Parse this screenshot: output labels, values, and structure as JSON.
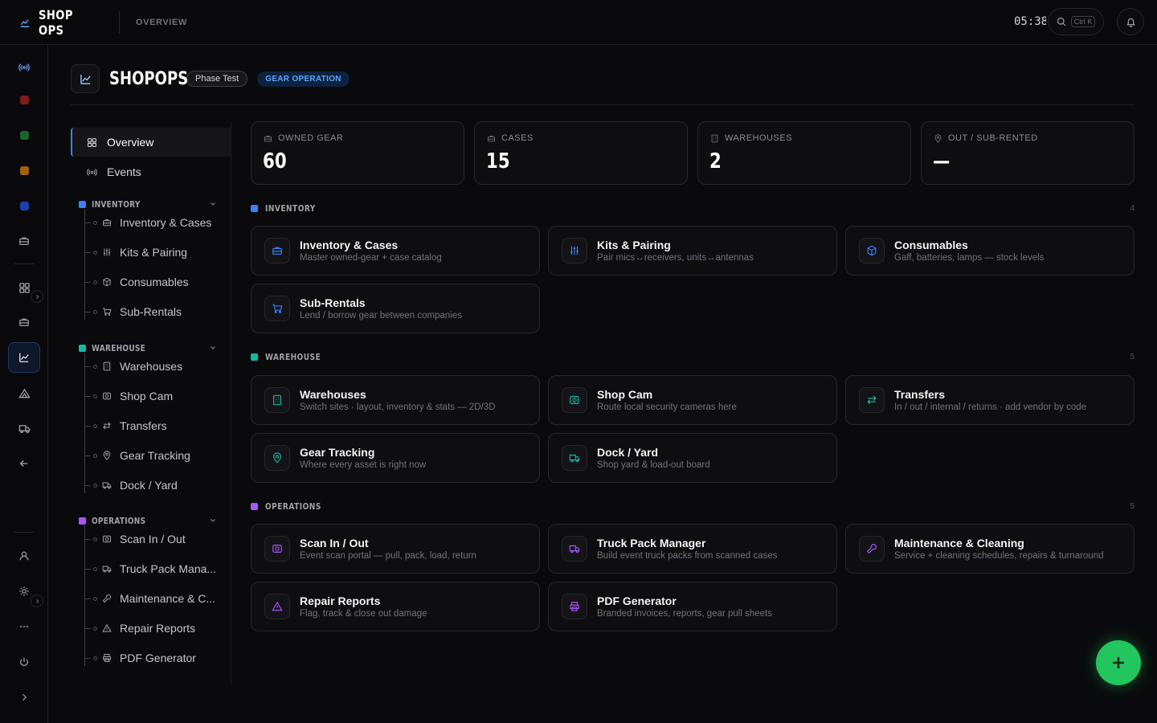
{
  "app": {
    "name": "SHOP OPS",
    "crumb": "OVERVIEW",
    "clock": "05:38",
    "search_kbd": "Ctrl K"
  },
  "rail": {
    "square_colors": [
      "#7f1d1d",
      "#166534",
      "#a16207",
      "#1e40af"
    ]
  },
  "page": {
    "title": "SHOPOPS",
    "chip_phase": "Phase Test",
    "chip_operation": "GEAR OPERATION"
  },
  "subnav": {
    "top": [
      {
        "label": "Overview",
        "icon": "grid-icon"
      },
      {
        "label": "Events",
        "icon": "broadcast-icon"
      }
    ],
    "groups": [
      {
        "label": "INVENTORY",
        "color": "#3b82f6",
        "items": [
          {
            "label": "Inventory & Cases",
            "icon": "briefcase-icon"
          },
          {
            "label": "Kits & Pairing",
            "icon": "sliders-icon"
          },
          {
            "label": "Consumables",
            "icon": "box-icon"
          },
          {
            "label": "Sub-Rentals",
            "icon": "cart-icon"
          }
        ]
      },
      {
        "label": "WAREHOUSE",
        "color": "#14b8a6",
        "items": [
          {
            "label": "Warehouses",
            "icon": "building-icon"
          },
          {
            "label": "Shop Cam",
            "icon": "camera-icon"
          },
          {
            "label": "Transfers",
            "icon": "transfer-icon"
          },
          {
            "label": "Gear Tracking",
            "icon": "pin-icon"
          },
          {
            "label": "Dock / Yard",
            "icon": "truck-icon"
          }
        ]
      },
      {
        "label": "OPERATIONS",
        "color": "#a855f7",
        "items": [
          {
            "label": "Scan In / Out",
            "icon": "scan-icon"
          },
          {
            "label": "Truck Pack Mana...",
            "icon": "truck-icon"
          },
          {
            "label": "Maintenance & C...",
            "icon": "wrench-icon"
          },
          {
            "label": "Repair Reports",
            "icon": "warning-icon"
          },
          {
            "label": "PDF Generator",
            "icon": "printer-icon"
          }
        ]
      }
    ]
  },
  "stats": [
    {
      "label": "OWNED GEAR",
      "value": "60",
      "icon": "briefcase-icon"
    },
    {
      "label": "CASES",
      "value": "15",
      "icon": "briefcase-icon"
    },
    {
      "label": "WAREHOUSES",
      "value": "2",
      "icon": "building-icon"
    },
    {
      "label": "OUT / SUB-RENTED",
      "value": "—",
      "icon": "pin-icon"
    }
  ],
  "sections": [
    {
      "label": "INVENTORY",
      "count": "4",
      "color": "#3b82f6",
      "cards": [
        {
          "title": "Inventory & Cases",
          "desc": "Master owned-gear + case catalog",
          "icon": "briefcase-icon"
        },
        {
          "title": "Kits & Pairing",
          "desc": "Pair mics↔receivers, units↔antennas",
          "icon": "sliders-icon"
        },
        {
          "title": "Consumables",
          "desc": "Gaff, batteries, lamps — stock levels",
          "icon": "box-icon"
        },
        {
          "title": "Sub-Rentals",
          "desc": "Lend / borrow gear between companies",
          "icon": "cart-icon"
        }
      ]
    },
    {
      "label": "WAREHOUSE",
      "count": "5",
      "color": "#14b8a6",
      "cards": [
        {
          "title": "Warehouses",
          "desc": "Switch sites · layout, inventory & stats — 2D/3D",
          "icon": "building-icon"
        },
        {
          "title": "Shop Cam",
          "desc": "Route local security cameras here",
          "icon": "camera-icon"
        },
        {
          "title": "Transfers",
          "desc": "In / out / internal / returns · add vendor by code",
          "icon": "transfer-icon"
        },
        {
          "title": "Gear Tracking",
          "desc": "Where every asset is right now",
          "icon": "pin-icon"
        },
        {
          "title": "Dock / Yard",
          "desc": "Shop yard & load-out board",
          "icon": "truck-icon"
        }
      ]
    },
    {
      "label": "OPERATIONS",
      "count": "5",
      "color": "#a855f7",
      "cards": [
        {
          "title": "Scan In / Out",
          "desc": "Event scan portal — pull, pack, load, return",
          "icon": "scan-icon"
        },
        {
          "title": "Truck Pack Manager",
          "desc": "Build event truck packs from scanned cases",
          "icon": "truck-icon"
        },
        {
          "title": "Maintenance & Cleaning",
          "desc": "Service + cleaning schedules, repairs & turnaround",
          "icon": "wrench-icon"
        },
        {
          "title": "Repair Reports",
          "desc": "Flag, track & close out damage",
          "icon": "warning-icon"
        },
        {
          "title": "PDF Generator",
          "desc": "Branded invoices, reports, gear pull sheets",
          "icon": "printer-icon"
        }
      ]
    }
  ],
  "fab": {
    "icon": "plus-icon",
    "color": "#22c55e"
  }
}
